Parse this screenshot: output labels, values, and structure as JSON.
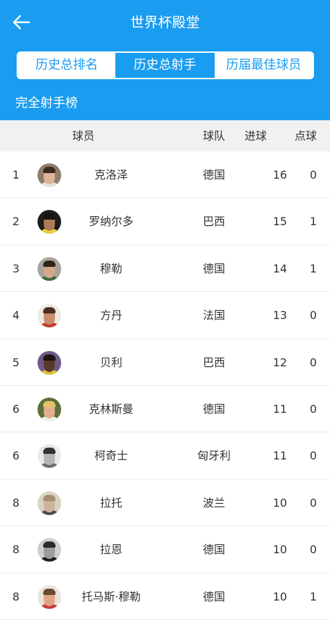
{
  "header": {
    "title": "世界杯殿堂"
  },
  "tabs": [
    {
      "label": "历史总排名",
      "active": false
    },
    {
      "label": "历史总射手",
      "active": true
    },
    {
      "label": "历届最佳球员",
      "active": false
    }
  ],
  "section_title": "完全射手榜",
  "columns": {
    "player": "球员",
    "team": "球队",
    "goals": "进球",
    "penalties": "点球"
  },
  "rows": [
    {
      "rank": "1",
      "name": "克洛泽",
      "team": "德国",
      "goals": "16",
      "penalties": "0"
    },
    {
      "rank": "2",
      "name": "罗纳尔多",
      "team": "巴西",
      "goals": "15",
      "penalties": "1"
    },
    {
      "rank": "3",
      "name": "穆勒",
      "team": "德国",
      "goals": "14",
      "penalties": "1"
    },
    {
      "rank": "4",
      "name": "方丹",
      "team": "法国",
      "goals": "13",
      "penalties": "0"
    },
    {
      "rank": "5",
      "name": "贝利",
      "team": "巴西",
      "goals": "12",
      "penalties": "0"
    },
    {
      "rank": "6",
      "name": "克林斯曼",
      "team": "德国",
      "goals": "11",
      "penalties": "0"
    },
    {
      "rank": "6",
      "name": "柯奇士",
      "team": "匈牙利",
      "goals": "11",
      "penalties": "0"
    },
    {
      "rank": "8",
      "name": "拉托",
      "team": "波兰",
      "goals": "10",
      "penalties": "0"
    },
    {
      "rank": "8",
      "name": "拉恩",
      "team": "德国",
      "goals": "10",
      "penalties": "0"
    },
    {
      "rank": "8",
      "name": "托马斯·穆勒",
      "team": "德国",
      "goals": "10",
      "penalties": "1"
    }
  ],
  "colors": {
    "accent": "#1a9cf0",
    "header_bg": "#f1f1f1",
    "divider": "#ececec"
  },
  "icons": {
    "back": "arrow-left-icon",
    "avatar": "player-photo"
  }
}
